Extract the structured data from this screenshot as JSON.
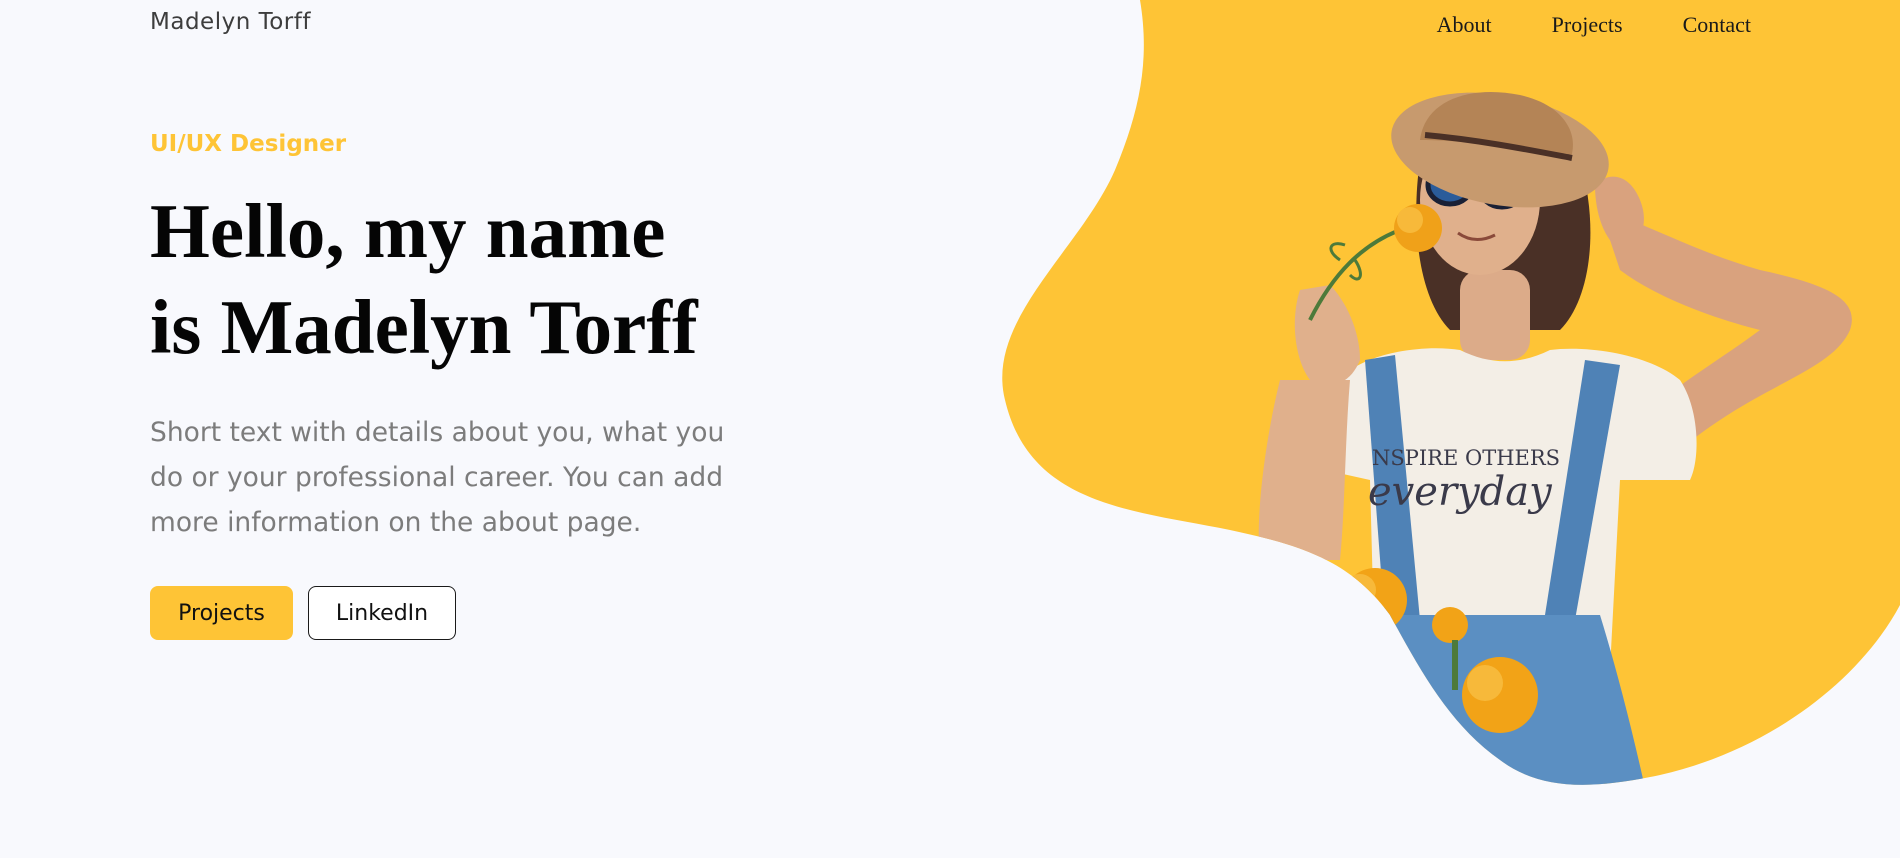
{
  "header": {
    "logo": "Madelyn Torff",
    "nav": [
      {
        "label": "About"
      },
      {
        "label": "Projects"
      },
      {
        "label": "Contact"
      }
    ]
  },
  "hero": {
    "eyebrow": "UI/UX Designer",
    "headline_line1": "Hello, my name",
    "headline_line2": "is Madelyn Torff",
    "intro": "Short text with details about you, what you do or your professional career. You can add more information on the about page.",
    "primary_button": "Projects",
    "secondary_button": "LinkedIn",
    "shirt_text_line1": "NSPIRE OTHERS",
    "shirt_text_line2": "everyday"
  },
  "colors": {
    "accent": "#fec436",
    "background": "#f8f9fd",
    "text_muted": "#7c7c7c"
  }
}
